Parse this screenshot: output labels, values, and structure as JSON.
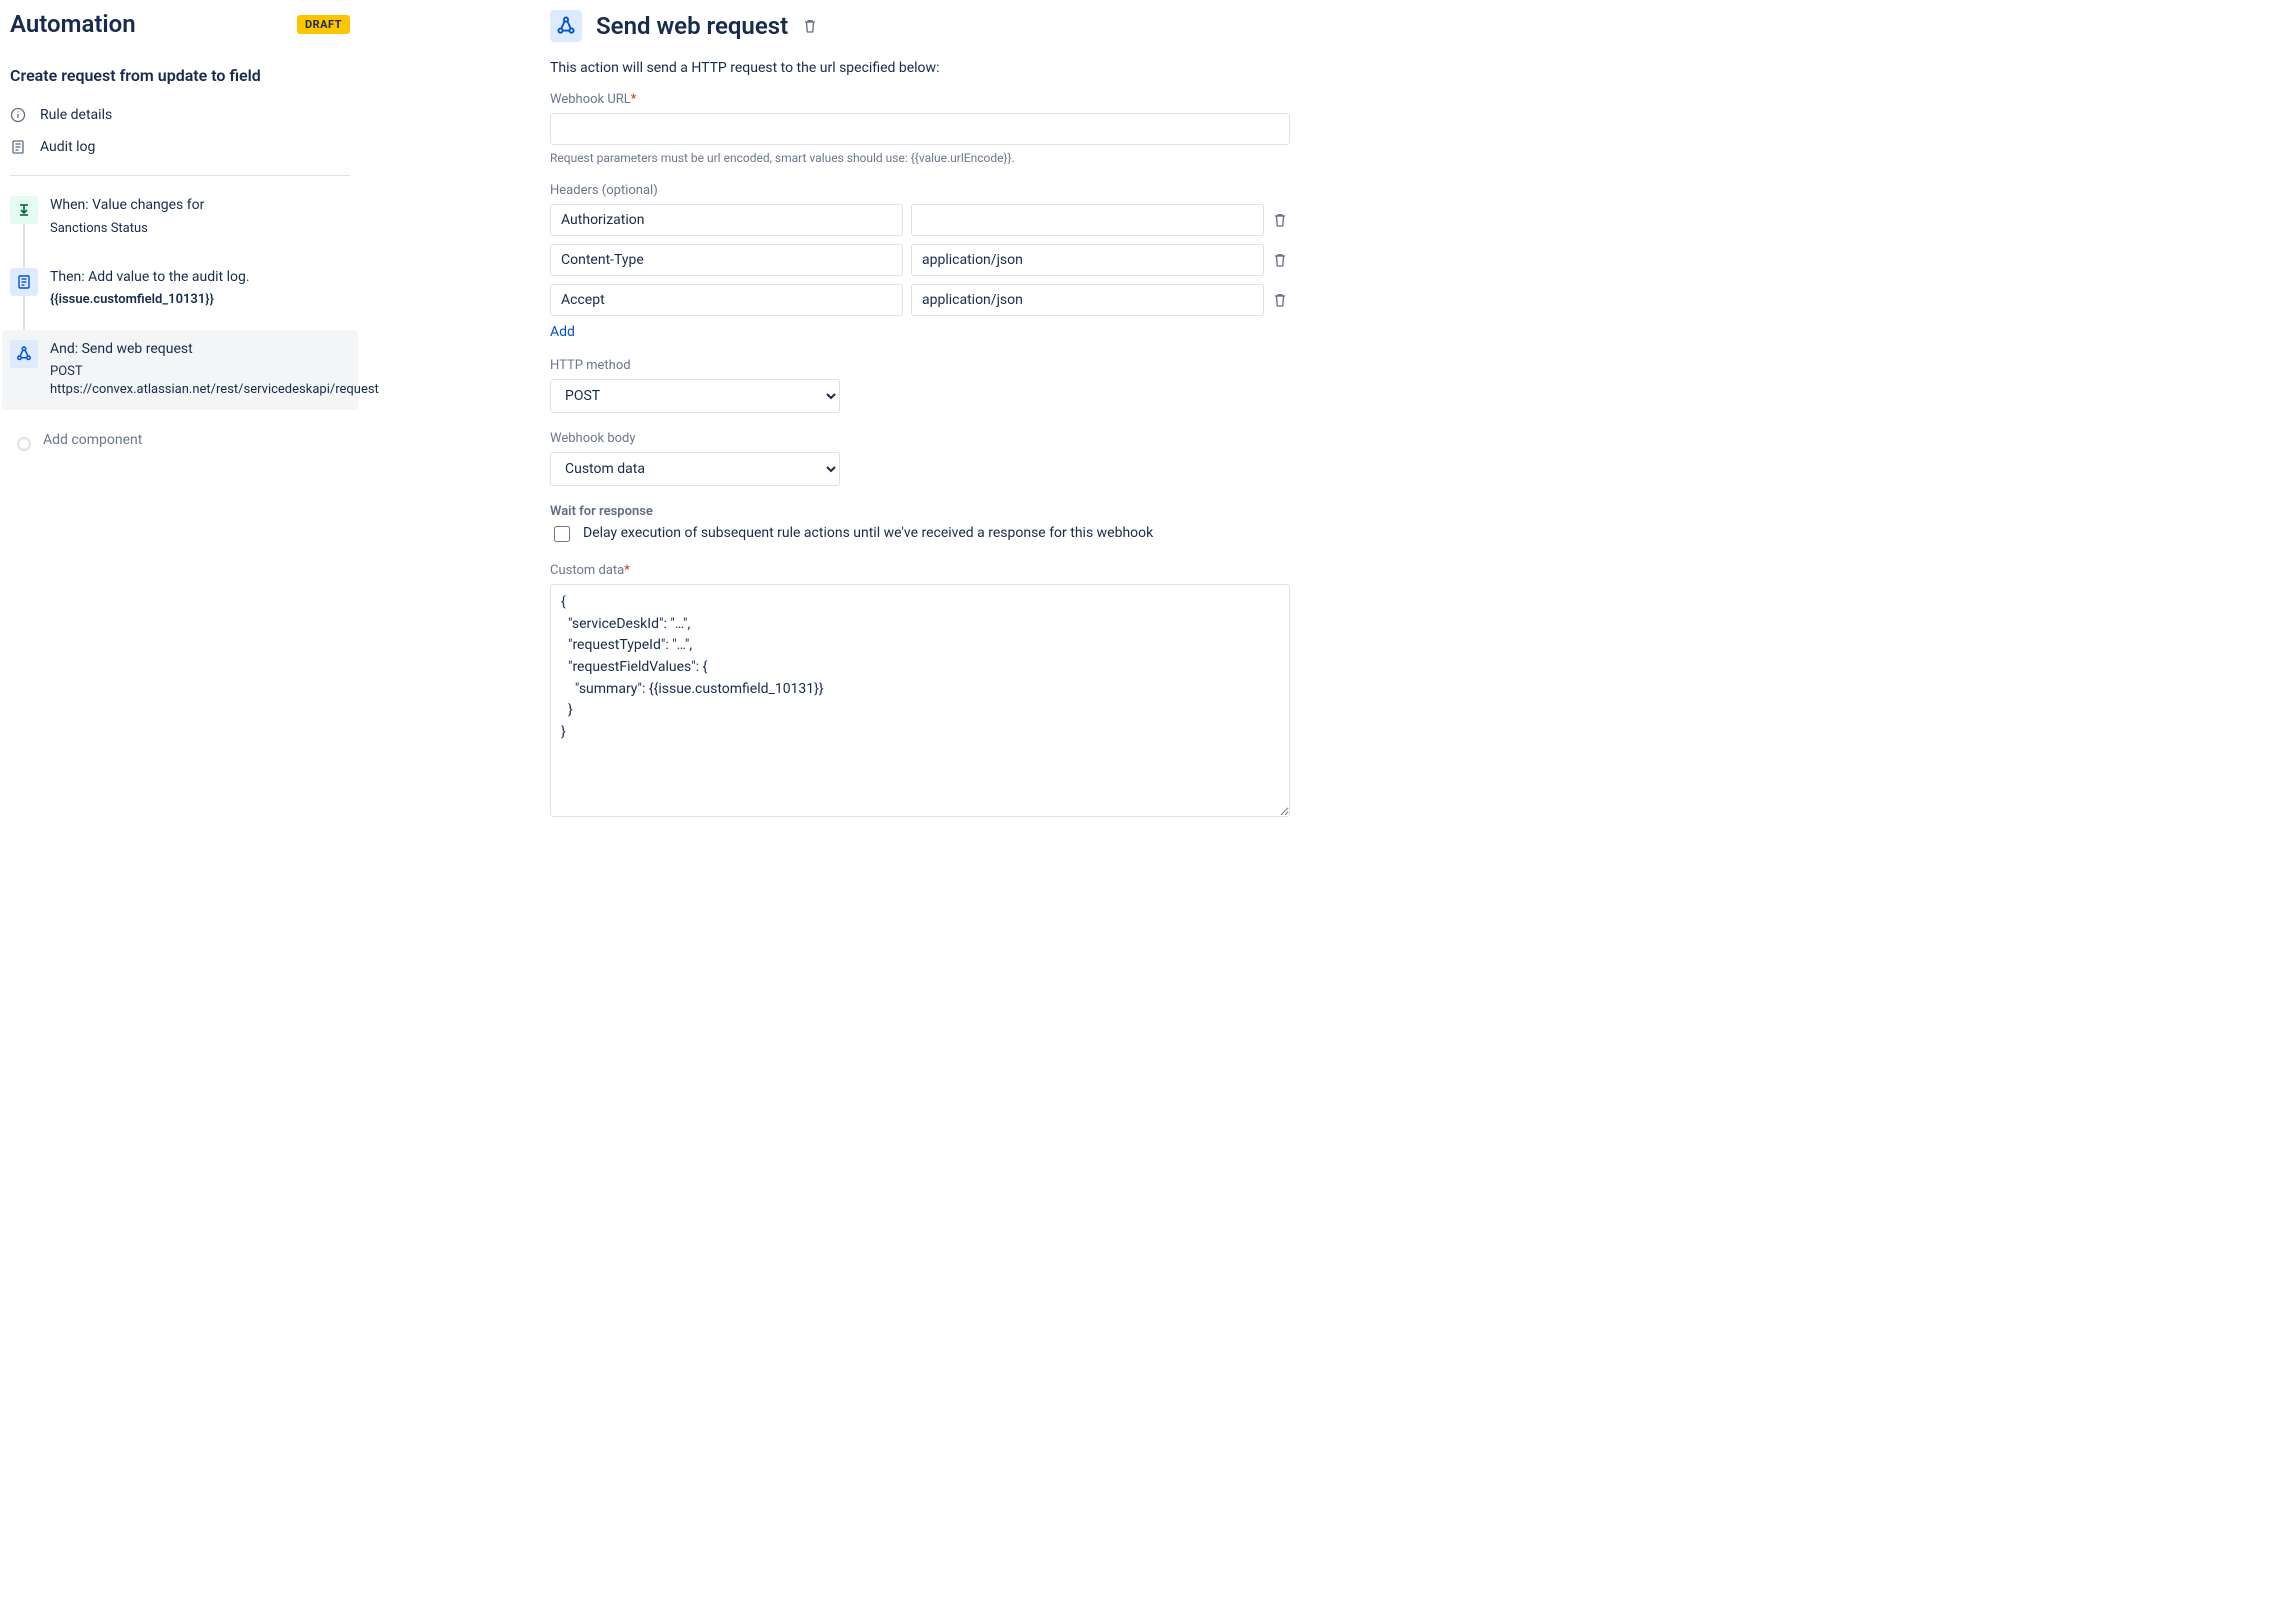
{
  "header": {
    "title": "Automation",
    "status_badge": "DRAFT"
  },
  "rule": {
    "name": "Create request from update to field",
    "nav": {
      "details": "Rule details",
      "audit": "Audit log"
    }
  },
  "steps": {
    "trigger": {
      "label": "When: Value changes for",
      "detail": "Sanctions Status"
    },
    "action1": {
      "label": "Then: Add value to the audit log.",
      "detail": "{{issue.customfield_10131}}"
    },
    "action2": {
      "label": "And: Send web request",
      "method": "POST",
      "url": "https://convex.atlassian.net/rest/servicedeskapi/request"
    },
    "add_component": "Add component"
  },
  "panel": {
    "title": "Send web request",
    "intro": "This action will send a HTTP request to the url specified below:",
    "webhook_url_label": "Webhook URL",
    "webhook_url_value": "",
    "webhook_url_help": "Request parameters must be url encoded, smart values should use: {{value.urlEncode}}.",
    "headers_label": "Headers (optional)",
    "headers": [
      {
        "name": "Authorization",
        "value": ""
      },
      {
        "name": "Content-Type",
        "value": "application/json"
      },
      {
        "name": "Accept",
        "value": "application/json"
      }
    ],
    "add_label": "Add",
    "http_method_label": "HTTP method",
    "http_method_value": "POST",
    "webhook_body_label": "Webhook body",
    "webhook_body_value": "Custom data",
    "wait_label": "Wait for response",
    "delay_label": "Delay execution of subsequent rule actions until we've received a response for this webhook",
    "delay_checked": false,
    "custom_data_label": "Custom data",
    "custom_data_value": "{\n  \"serviceDeskId\": \"…\",\n  \"requestTypeId\": \"…\",\n  \"requestFieldValues\": {\n    \"summary\": {{issue.customfield_10131}}\n  }\n}"
  }
}
